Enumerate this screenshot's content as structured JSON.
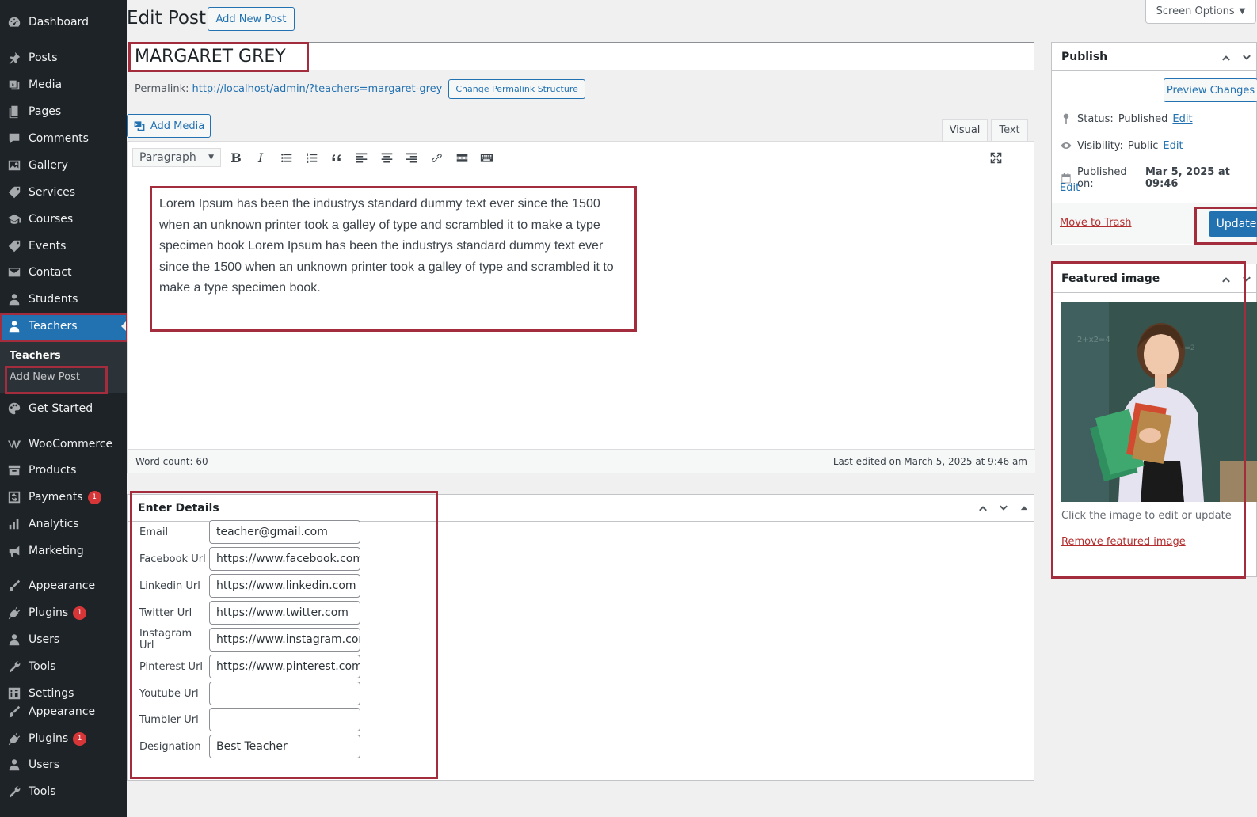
{
  "sidebar": {
    "items": [
      {
        "label": "Dashboard",
        "icon": "dashboard-icon"
      },
      {
        "label": "Posts",
        "icon": "pin-icon"
      },
      {
        "label": "Media",
        "icon": "media-icon"
      },
      {
        "label": "Pages",
        "icon": "pages-icon"
      },
      {
        "label": "Comments",
        "icon": "comments-icon"
      },
      {
        "label": "Gallery",
        "icon": "gallery-icon"
      },
      {
        "label": "Services",
        "icon": "tag-icon"
      },
      {
        "label": "Courses",
        "icon": "courses-icon"
      },
      {
        "label": "Events",
        "icon": "tag-icon"
      },
      {
        "label": "Contact",
        "icon": "mail-icon"
      },
      {
        "label": "Students",
        "icon": "user-icon"
      },
      {
        "label": "Teachers",
        "icon": "user-icon"
      },
      {
        "label": "Get Started",
        "icon": "palette-icon"
      },
      {
        "label": "WooCommerce",
        "icon": "woocommerce-icon"
      },
      {
        "label": "Products",
        "icon": "archive-icon"
      },
      {
        "label": "Payments",
        "icon": "dollar-icon",
        "badge": "1"
      },
      {
        "label": "Analytics",
        "icon": "bar-chart-icon"
      },
      {
        "label": "Marketing",
        "icon": "megaphone-icon"
      },
      {
        "label": "Appearance",
        "icon": "brush-icon"
      },
      {
        "label": "Plugins",
        "icon": "plug-icon",
        "badge": "1"
      },
      {
        "label": "Users",
        "icon": "user-icon"
      },
      {
        "label": "Tools",
        "icon": "wrench-icon"
      },
      {
        "label": "Settings",
        "icon": "settings-icon"
      },
      {
        "label": "Appearance",
        "icon": "brush-icon"
      },
      {
        "label": "Plugins",
        "icon": "plug-icon",
        "badge": "1"
      },
      {
        "label": "Users",
        "icon": "user-icon"
      },
      {
        "label": "Tools",
        "icon": "wrench-icon"
      }
    ],
    "submenu": {
      "title": "Teachers",
      "item": "Add New Post"
    }
  },
  "header": {
    "title": "Edit Post",
    "add_new_label": "Add New Post",
    "screen_options_label": "Screen Options"
  },
  "post": {
    "title": "MARGARET GREY",
    "permalink_label": "Permalink:",
    "permalink_url": "http://localhost/admin/?teachers=margaret-grey",
    "change_permalink_label": "Change Permalink Structure"
  },
  "editor": {
    "add_media_label": "Add Media",
    "tab_visual": "Visual",
    "tab_text": "Text",
    "format_value": "Paragraph",
    "content_lines": [
      "Lorem Ipsum has been the industrys standard dummy text ever since the 1500",
      "when an unknown printer took a galley of type and scrambled it to make a type",
      "specimen book Lorem Ipsum has been the industrys standard dummy text ever",
      "since the 1500 when an unknown printer took a galley of type and scrambled it to",
      "make a type specimen book."
    ],
    "word_count": "Word count: 60",
    "last_edited": "Last edited on March 5, 2025 at 9:46 am"
  },
  "details": {
    "title": "Enter Details",
    "fields": [
      {
        "label": "Email",
        "value": "teacher@gmail.com"
      },
      {
        "label": "Facebook Url",
        "value": "https://www.facebook.com"
      },
      {
        "label": "Linkedin Url",
        "value": "https://www.linkedin.com"
      },
      {
        "label": "Twitter Url",
        "value": "https://www.twitter.com"
      },
      {
        "label": "Instagram Url",
        "value": "https://www.instagram.com"
      },
      {
        "label": "Pinterest Url",
        "value": "https://www.pinterest.com"
      },
      {
        "label": "Youtube Url",
        "value": ""
      },
      {
        "label": "Tumbler Url",
        "value": ""
      },
      {
        "label": "Designation",
        "value": "Best Teacher"
      }
    ]
  },
  "publish": {
    "title": "Publish",
    "preview_label": "Preview Changes",
    "status_label": "Status:",
    "status_value": "Published",
    "visibility_label": "Visibility:",
    "visibility_value": "Public",
    "published_on_label": "Published on:",
    "published_on_value": "Mar 5, 2025 at 09:46",
    "edit_label": "Edit",
    "trash_label": "Move to Trash",
    "update_label": "Update"
  },
  "featured": {
    "title": "Featured image",
    "hint": "Click the image to edit or update",
    "remove_label": "Remove featured image"
  },
  "colors": {
    "sidebar_bg": "#1d2327",
    "accent": "#2271b1",
    "highlight_border": "#a32d3c",
    "badge": "#d63638"
  }
}
